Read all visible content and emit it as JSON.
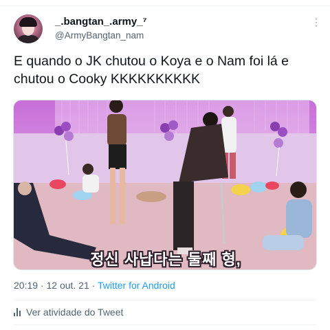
{
  "tweet": {
    "display_name": "_.bangtan_.army_⁷",
    "handle": "@ArmyBangtan_nam",
    "text": "E quando o JK chutou o Koya e o Nam foi lá e\nchutou o Cooky KKKKKKKKKK",
    "media_subtitle": "정신 사납다는 둘째 형,",
    "timestamp": "20:19 · 12 out. 21 · ",
    "client": "Twitter for Android",
    "activity_label": "Ver atividade do Tweet"
  },
  "icons": {
    "more": "more-icon",
    "activity": "bar-chart-icon"
  },
  "colors": {
    "link": "#1d9bf0",
    "secondary_text": "#536471",
    "primary_text": "#0f1419",
    "media_background": "#d389df"
  }
}
